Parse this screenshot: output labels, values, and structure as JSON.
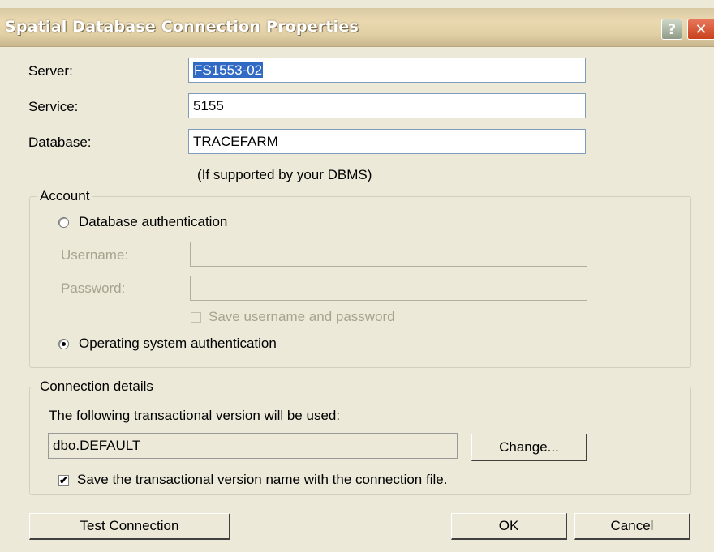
{
  "window": {
    "title": "Spatial Database Connection Properties",
    "help_label": "?",
    "close_label": "✕"
  },
  "fields": {
    "server_label": "Server:",
    "server_value": "FS1553-02",
    "service_label": "Service:",
    "service_value": "5155",
    "database_label": "Database:",
    "database_value": "TRACEFARM",
    "database_hint": "(If supported by your DBMS)"
  },
  "account": {
    "legend": "Account",
    "db_auth_label": "Database authentication",
    "db_auth_selected": false,
    "username_label": "Username:",
    "username_value": "",
    "password_label": "Password:",
    "password_value": "",
    "save_credentials_label": "Save username and password",
    "save_credentials_checked": false,
    "os_auth_label": "Operating system authentication",
    "os_auth_selected": true
  },
  "connection": {
    "legend": "Connection details",
    "description": "The following transactional version will be used:",
    "version_value": "dbo.DEFAULT",
    "change_label": "Change...",
    "save_version_label": "Save the transactional version name with the connection file.",
    "save_version_checked": true,
    "check_mark": "✔"
  },
  "buttons": {
    "test_connection": "Test Connection",
    "ok": "OK",
    "cancel": "Cancel"
  }
}
